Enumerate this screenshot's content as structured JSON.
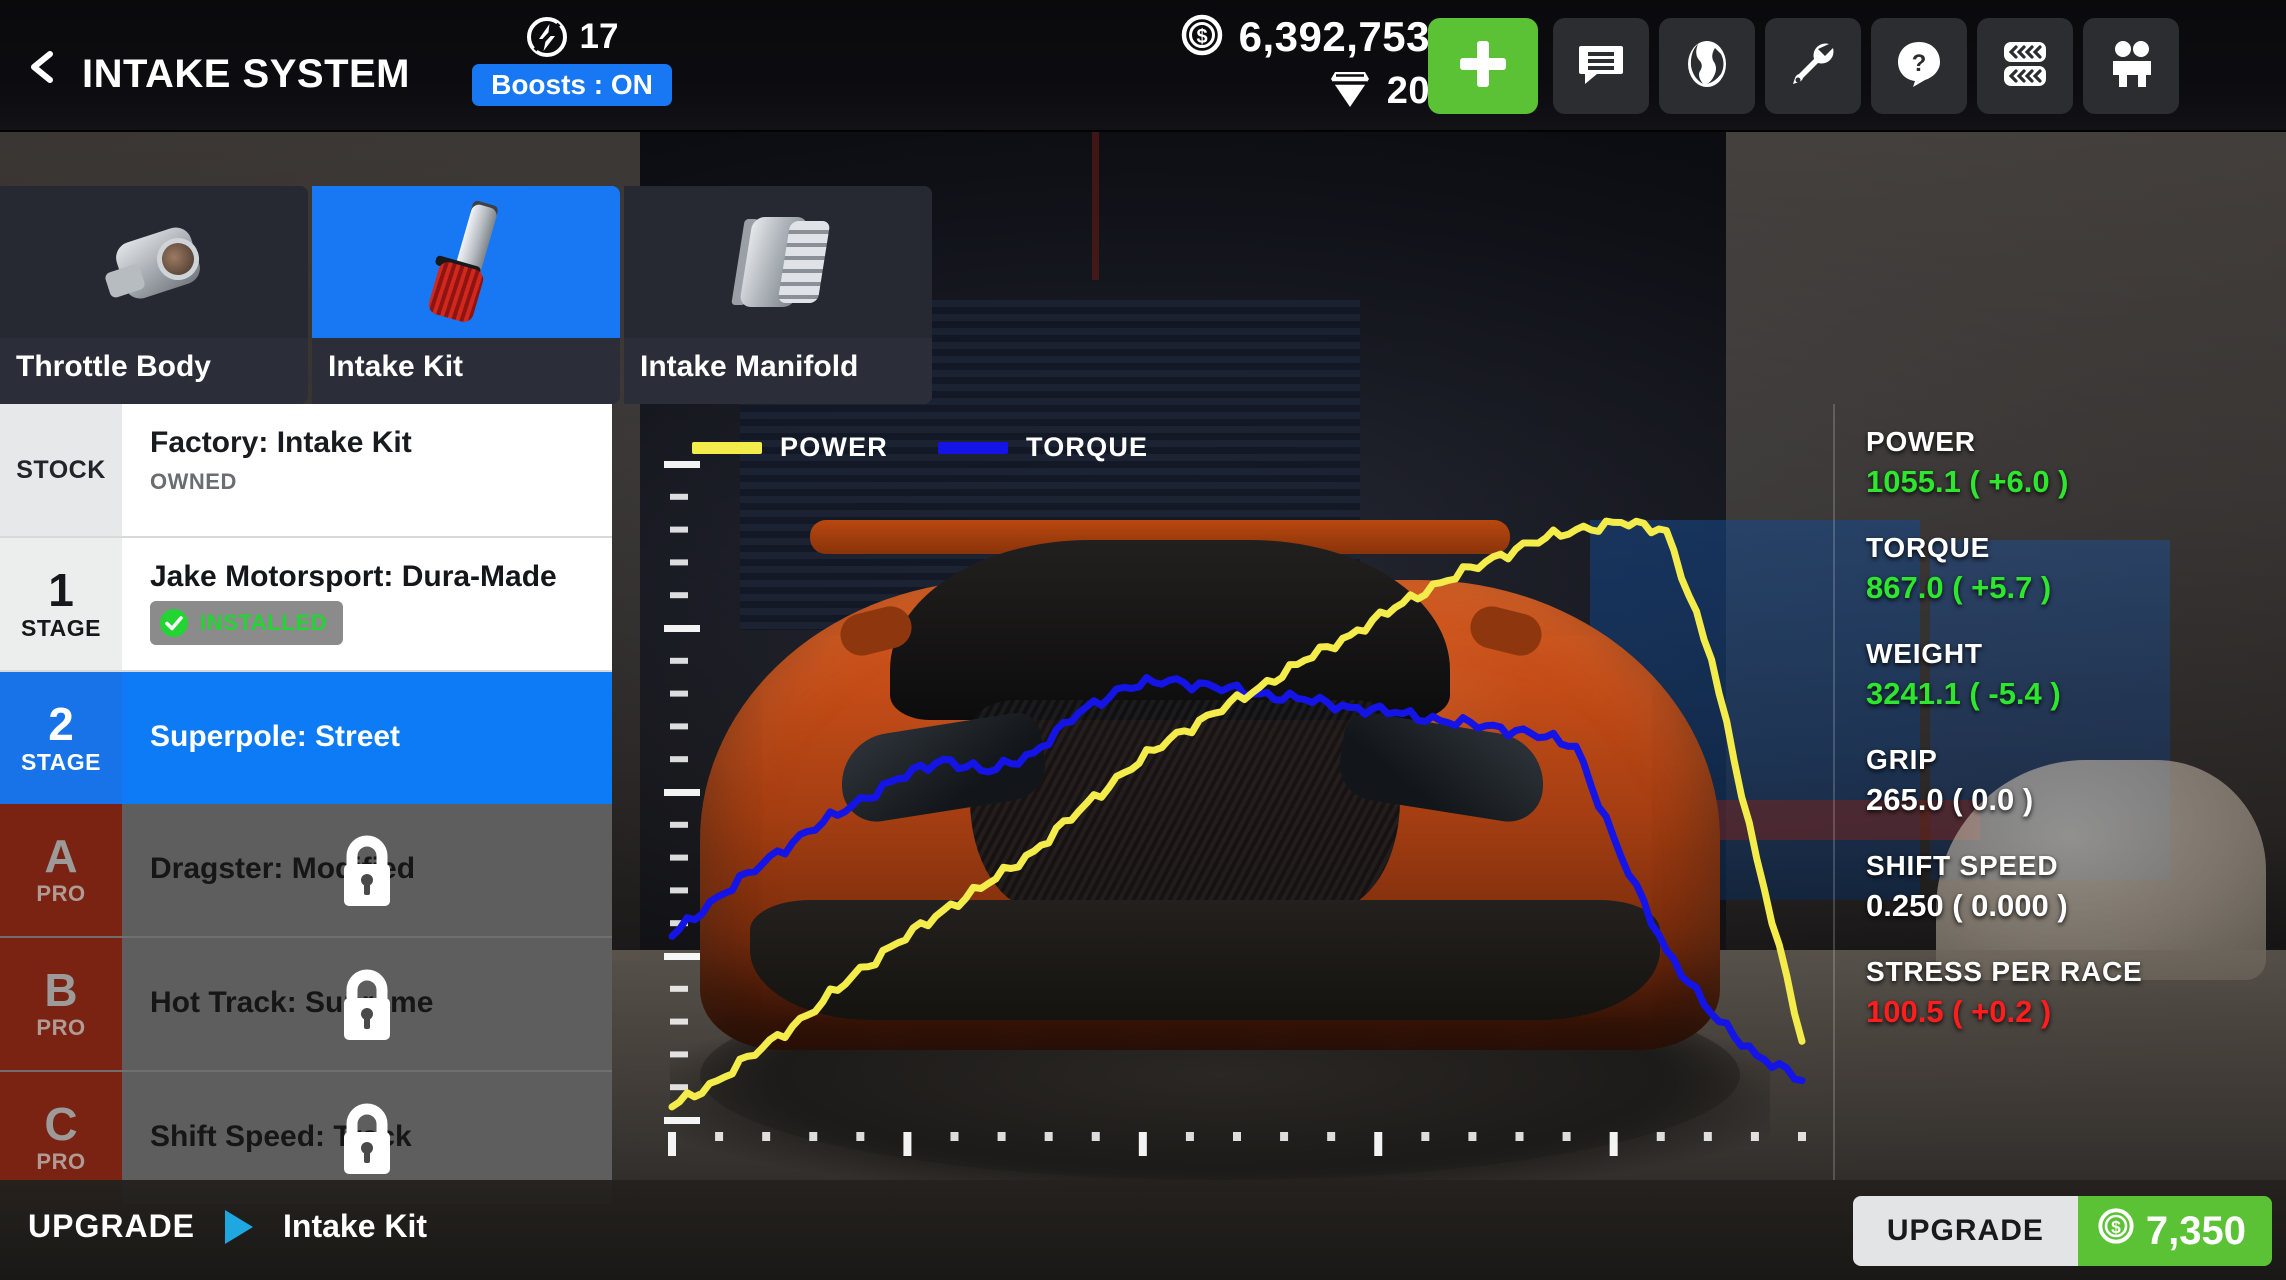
{
  "header": {
    "back_icon": "chevron-left-icon",
    "title": "INTAKE SYSTEM",
    "boost": {
      "icon": "boost-bolt-icon",
      "count": "17",
      "toggle_label": "Boosts : ON"
    },
    "currency": {
      "cash_icon": "coin-dollar-icon",
      "cash": "6,392,753",
      "gem_icon": "gem-icon",
      "gems": "20"
    },
    "add_button": {
      "icon": "plus-icon",
      "label": "+"
    },
    "icon_buttons": [
      {
        "name": "chat-icon",
        "label": "Chat"
      },
      {
        "name": "globe-icon",
        "label": "World"
      },
      {
        "name": "wrench-icon",
        "label": "Garage"
      },
      {
        "name": "question-icon",
        "label": "Help"
      },
      {
        "name": "tires-icon",
        "label": "Tires"
      },
      {
        "name": "crew-icon",
        "label": "Crew"
      }
    ]
  },
  "category_tabs": [
    {
      "label": "Throttle Body",
      "icon": "throttle-body-icon",
      "active": false
    },
    {
      "label": "Intake Kit",
      "icon": "intake-kit-icon",
      "active": true
    },
    {
      "label": "Intake Manifold",
      "icon": "intake-manifold-icon",
      "active": false
    }
  ],
  "parts": [
    {
      "badge_num": "",
      "badge_label": "STOCK",
      "name": "Factory: Intake Kit",
      "status": "OWNED",
      "state": "stock"
    },
    {
      "badge_num": "1",
      "badge_label": "STAGE",
      "name": "Jake Motorsport: Dura-Made",
      "status": "INSTALLED",
      "state": "installed"
    },
    {
      "badge_num": "2",
      "badge_label": "STAGE",
      "name": "Superpole: Street",
      "status": "",
      "state": "selected"
    },
    {
      "badge_num": "A",
      "badge_label": "PRO",
      "name": "Dragster: Modified",
      "status": "",
      "state": "locked"
    },
    {
      "badge_num": "B",
      "badge_label": "PRO",
      "name": "Hot Track: Supreme",
      "status": "",
      "state": "locked"
    },
    {
      "badge_num": "C",
      "badge_label": "PRO",
      "name": "Shift Speed: Track",
      "status": "",
      "state": "locked"
    }
  ],
  "chart_data": {
    "type": "line",
    "title": "",
    "xlabel": "",
    "ylabel": "",
    "grid": false,
    "legend_position": "top-left",
    "axis_ticks": {
      "x_count": 24,
      "x_major_every": 5,
      "y_count": 20,
      "y_major_every": 5
    },
    "legend": [
      {
        "name": "POWER",
        "color": "#f3ec4b"
      },
      {
        "name": "TORQUE",
        "color": "#1414e6"
      }
    ],
    "x": [
      0,
      4,
      8,
      12,
      16,
      20,
      24,
      28,
      32,
      36,
      40,
      44,
      48,
      52,
      56,
      60,
      64,
      68,
      72,
      76,
      80,
      84,
      88,
      92,
      96,
      100
    ],
    "series": [
      {
        "name": "POWER",
        "color": "#f3ec4b",
        "values": [
          2,
          6,
          11,
          16,
          22,
          27,
          32,
          36,
          41,
          47,
          53,
          58,
          62,
          66,
          70,
          74,
          78,
          82,
          85,
          88,
          90,
          91,
          90,
          70,
          40,
          12
        ]
      },
      {
        "name": "TORQUE",
        "color": "#1414e6",
        "values": [
          28,
          34,
          39,
          44,
          48,
          52,
          55,
          53,
          56,
          62,
          66,
          67,
          66,
          65,
          64,
          63,
          62,
          61,
          60,
          59,
          57,
          40,
          26,
          16,
          10,
          6
        ]
      }
    ],
    "ylim": [
      0,
      100
    ],
    "xlim": [
      0,
      100
    ]
  },
  "stats": [
    {
      "label": "POWER",
      "value": "1055.1 ( +6.0 )",
      "color": "green"
    },
    {
      "label": "TORQUE",
      "value": "867.0 ( +5.7 )",
      "color": "green"
    },
    {
      "label": "WEIGHT",
      "value": "3241.1 ( -5.4 )",
      "color": "green"
    },
    {
      "label": "GRIP",
      "value": "265.0 ( 0.0 )",
      "color": "white"
    },
    {
      "label": "SHIFT SPEED",
      "value": "0.250 ( 0.000 )",
      "color": "white"
    },
    {
      "label": "STRESS PER RACE",
      "value": "100.5 ( +0.2 )",
      "color": "red"
    }
  ],
  "bottom": {
    "breadcrumb_action": "UPGRADE",
    "breadcrumb_arrow": "triangle-right-icon",
    "breadcrumb_target": "Intake Kit",
    "upgrade_button_label": "UPGRADE",
    "upgrade_price": "7,350",
    "upgrade_price_icon": "coin-dollar-icon"
  },
  "colors": {
    "accent_blue": "#0d7bf5",
    "accent_green": "#5bc236",
    "power_yellow": "#f3ec4b",
    "torque_blue": "#1414e6",
    "locked_red": "#7a2313",
    "stat_green": "#2ee62e",
    "stat_red": "#ff1d1d"
  }
}
